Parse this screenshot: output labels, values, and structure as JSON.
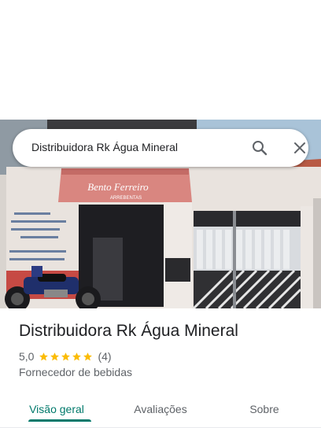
{
  "search": {
    "query": "Distribuidora Rk Água Mineral"
  },
  "place": {
    "title": "Distribuidora Rk Água Mineral",
    "rating": "5,0",
    "stars": 5,
    "review_count": "(4)",
    "category": "Fornecedor de bebidas",
    "photo_sign_text": "Bento Ferreiro",
    "photo_sign_subtext": "ARREBENTAS"
  },
  "tabs": [
    {
      "label": "Visão geral",
      "active": true
    },
    {
      "label": "Avaliações",
      "active": false
    },
    {
      "label": "Sobre",
      "active": false
    }
  ],
  "colors": {
    "accent": "#00796b",
    "star": "#fbbc04",
    "text_primary": "#202124",
    "text_secondary": "#5f6368"
  },
  "icons": [
    "search-icon",
    "close-icon",
    "star-icon"
  ]
}
